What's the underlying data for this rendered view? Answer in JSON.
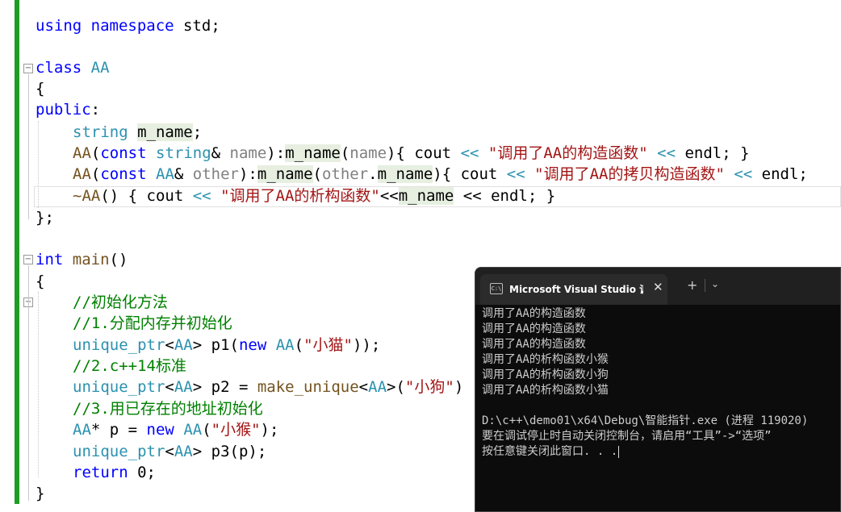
{
  "code": {
    "l1": [
      "using",
      " ",
      "namespace",
      " std;"
    ],
    "class_kw": "class",
    "class_name": "AA",
    "brace_open": "{",
    "public_kw": "public",
    "colon": ":",
    "member_type": "string",
    "member_name": "m_name",
    "semi": ";",
    "ctor1": {
      "a": "AA",
      "b": "(",
      "c": "const",
      "d": " ",
      "e": "string",
      "f": "& ",
      "g": "name",
      "h": "):",
      "i": "m_name",
      "j": "(",
      "k": "name",
      "l": "){ cout ",
      "m": "<<",
      "n": " ",
      "o": "\"调用了AA的构造函数\"",
      "p": " ",
      "q": "<<",
      "r": " endl; }"
    },
    "ctor2": {
      "a": "AA",
      "b": "(",
      "c": "const",
      "d": " ",
      "e": "AA",
      "f": "& ",
      "g": "other",
      "h": "):",
      "i": "m_name",
      "j": "(",
      "k": "other",
      "l": ".",
      "m": "m_name",
      "n": "){ cout ",
      "o": "<<",
      "p": " ",
      "q": "\"调用了AA的拷贝构造函数\"",
      "r": " ",
      "s": "<<",
      "t": " endl;"
    },
    "dtor": {
      "a": "~AA",
      "b": "() { cout ",
      "c": "<<",
      "d": " ",
      "e": "\"调用了AA的析构函数\"",
      "f": "<<",
      "g": "m_name",
      "h": " << endl; }"
    },
    "class_end": "};",
    "int_kw": "int",
    "main_name": "main",
    "main_parens": "()",
    "comment1": "//初始化方法",
    "comment2": "//1.分配内存并初始化",
    "p1": {
      "a": "unique_ptr",
      "b": "<",
      "c": "AA",
      "d": ">",
      "e": " p1(",
      "f": "new",
      "g": " ",
      "h": "AA",
      "i": "(",
      "j": "\"小猫\"",
      "k": "));"
    },
    "comment3": "//2.c++14标准",
    "p2": {
      "a": "unique_ptr",
      "b": "<",
      "c": "AA",
      "d": ">",
      "e": " p2 = ",
      "f": "make_unique",
      "g": "<",
      "h": "AA",
      "i": ">",
      "j": "(",
      "k": "\"小狗\"",
      "l": ")"
    },
    "comment4": "//3.用已存在的地址初始化",
    "rawp": {
      "a": "AA",
      "b": "* p = ",
      "c": "new",
      "d": " ",
      "e": "AA",
      "f": "(",
      "g": "\"小猴\"",
      "h": ");"
    },
    "p3": {
      "a": "unique_ptr",
      "b": "<",
      "c": "AA",
      "d": ">",
      "e": " p3(p);"
    },
    "ret": {
      "a": "return",
      "b": " 0;"
    },
    "brace_close": "}"
  },
  "console": {
    "tab_title": "Microsoft Visual Studio 调试控制台",
    "tab_icon_text": "C:\\",
    "close_glyph": "✕",
    "new_tab_glyph": "+",
    "dropdown_glyph": "⌄",
    "lines": [
      "调用了AA的构造函数",
      "调用了AA的构造函数",
      "调用了AA的构造函数",
      "调用了AA的析构函数小猴",
      "调用了AA的析构函数小狗",
      "调用了AA的析构函数小猫",
      "",
      "D:\\c++\\demo01\\x64\\Debug\\智能指针.exe (进程 119020)",
      "要在调试停止时自动关闭控制台，请启用“工具”->“选项”",
      "按任意键关闭此窗口. . ."
    ]
  }
}
